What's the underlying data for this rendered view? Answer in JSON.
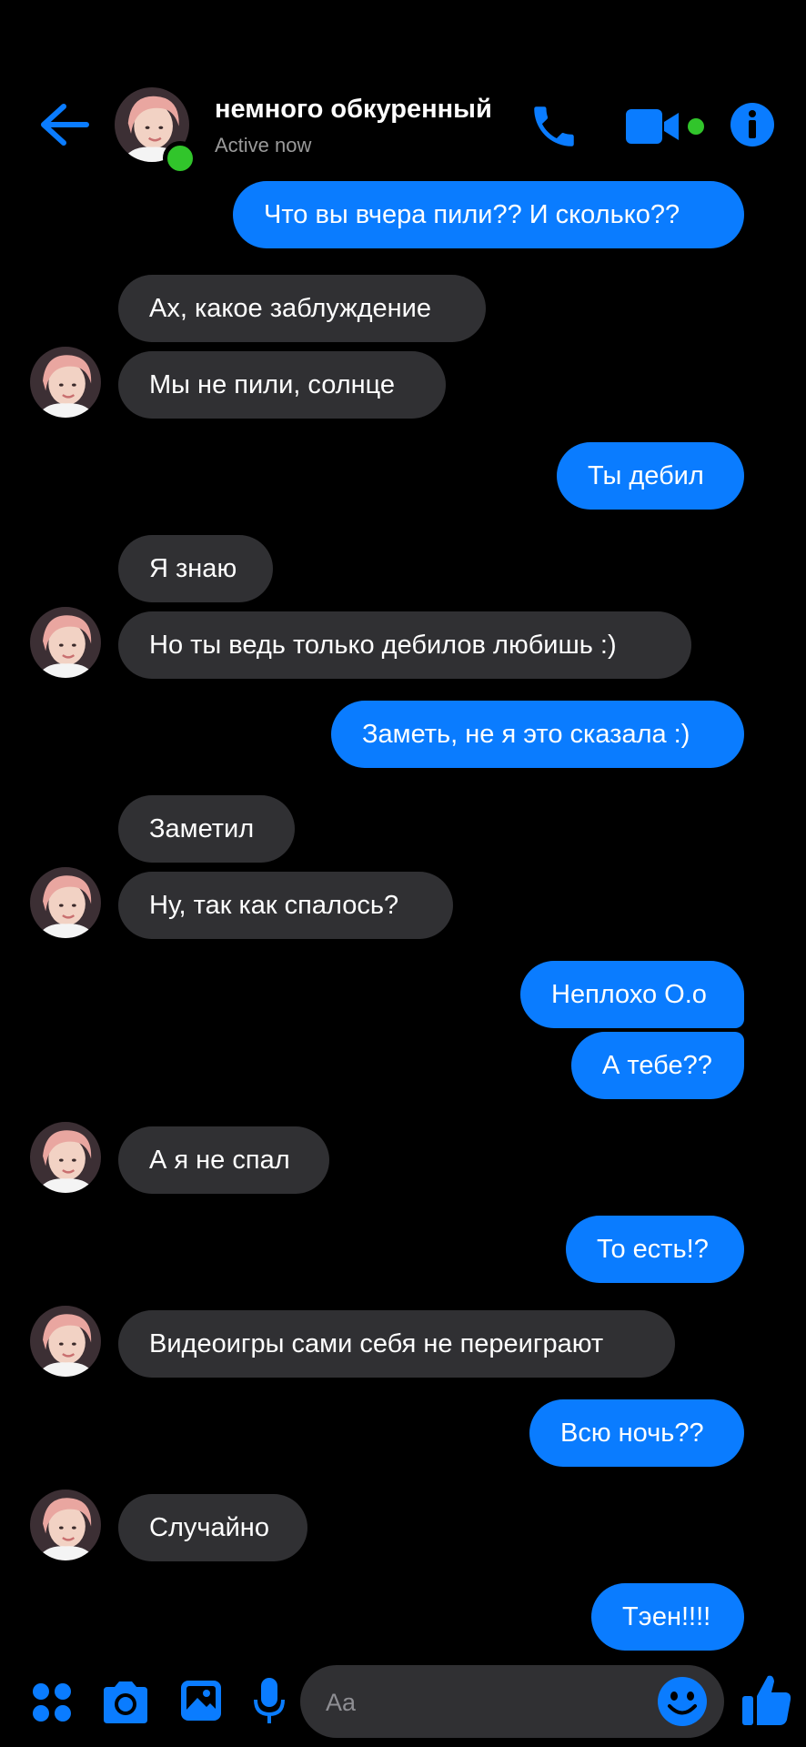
{
  "header": {
    "title": "немного обкуренный",
    "status": "Active now"
  },
  "messages": [
    {
      "side": "out",
      "text": "Что вы вчера пили?? И сколько??"
    },
    {
      "side": "in",
      "text": "Ах, какое заблуждение"
    },
    {
      "side": "in",
      "text": "Мы не пили, солнце"
    },
    {
      "side": "out",
      "text": "Ты дебил"
    },
    {
      "side": "in",
      "text": "Я знаю"
    },
    {
      "side": "in",
      "text": "Но ты ведь только дебилов любишь :)"
    },
    {
      "side": "out",
      "text": "Заметь, не я это сказала :)"
    },
    {
      "side": "in",
      "text": "Заметил"
    },
    {
      "side": "in",
      "text": "Ну, так как спалось?"
    },
    {
      "side": "out",
      "text": "Неплохо О.о"
    },
    {
      "side": "out",
      "text": "А тебе??"
    },
    {
      "side": "in",
      "text": "А я не спал"
    },
    {
      "side": "out",
      "text": "То есть!?"
    },
    {
      "side": "in",
      "text": "Видеоигры сами себя не переиграют"
    },
    {
      "side": "out",
      "text": "Всю ночь??"
    },
    {
      "side": "in",
      "text": "Случайно"
    },
    {
      "side": "out",
      "text": "Тэен!!!!"
    }
  ],
  "composer": {
    "placeholder": "Aa"
  },
  "colors": {
    "accent": "#0a7cff",
    "incoming_bubble": "#303033",
    "online": "#31c52b"
  },
  "icons": [
    "back-arrow-icon",
    "phone-icon",
    "video-camera-icon",
    "info-icon",
    "apps-grid-icon",
    "camera-icon",
    "image-icon",
    "microphone-icon",
    "emoji-icon",
    "thumbs-up-icon"
  ]
}
